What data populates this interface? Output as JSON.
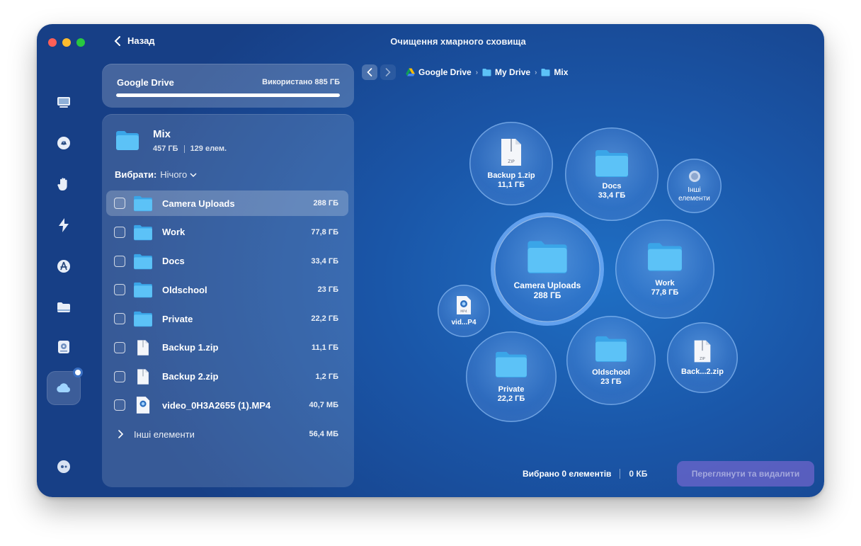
{
  "header": {
    "back_label": "Назад",
    "title": "Очищення хмарного сховища"
  },
  "drive": {
    "name": "Google Drive",
    "used_label": "Використано 885 ГБ",
    "usage_fraction": 1.0
  },
  "folder": {
    "name": "Mix",
    "size": "457 ГБ",
    "count": "129 елем.",
    "select_label": "Вибрати:",
    "select_value": "Нічого"
  },
  "items": [
    {
      "label": "Camera Uploads",
      "size": "288 ГБ",
      "icon": "folder-icon",
      "highlight": true
    },
    {
      "label": "Work",
      "size": "77,8 ГБ",
      "icon": "folder-icon"
    },
    {
      "label": "Docs",
      "size": "33,4 ГБ",
      "icon": "folder-icon"
    },
    {
      "label": "Oldschool",
      "size": "23 ГБ",
      "icon": "folder-icon"
    },
    {
      "label": "Private",
      "size": "22,2 ГБ",
      "icon": "folder-icon"
    },
    {
      "label": "Backup 1.zip",
      "size": "11,1 ГБ",
      "icon": "zip-file-icon"
    },
    {
      "label": "Backup 2.zip",
      "size": "1,2 ГБ",
      "icon": "zip-file-icon"
    },
    {
      "label": "video_0H3A2655 (1).MP4",
      "size": "40,7 МБ",
      "icon": "video-file-icon"
    }
  ],
  "other": {
    "label": "Інші елементи",
    "size": "56,4 МБ"
  },
  "breadcrumb": [
    "Google Drive",
    "My Drive",
    "Mix"
  ],
  "bubbles": {
    "backup1": {
      "label": "Backup 1.zip",
      "size": "11,1 ГБ",
      "zip_tag": "ZIP"
    },
    "docs": {
      "label": "Docs",
      "size": "33,4 ГБ"
    },
    "other": {
      "label": "Інші\nелементи"
    },
    "camera": {
      "label": "Camera Uploads",
      "size": "288 ГБ"
    },
    "work": {
      "label": "Work",
      "size": "77,8 ГБ"
    },
    "video": {
      "label": "vid...P4",
      "tag": "MP4"
    },
    "private": {
      "label": "Private",
      "size": "22,2 ГБ"
    },
    "oldschool": {
      "label": "Oldschool",
      "size": "23 ГБ"
    },
    "backup2": {
      "label": "Back...2.zip",
      "zip_tag": "ZIP"
    }
  },
  "footer": {
    "selected_label": "Вибрано 0 елементів",
    "selected_size": "0 КБ",
    "review_button": "Переглянути та видалити"
  },
  "colors": {
    "folder": "#4fb6f3",
    "review_button": "#8c6edc",
    "accent_ring": "#78b4ff"
  }
}
